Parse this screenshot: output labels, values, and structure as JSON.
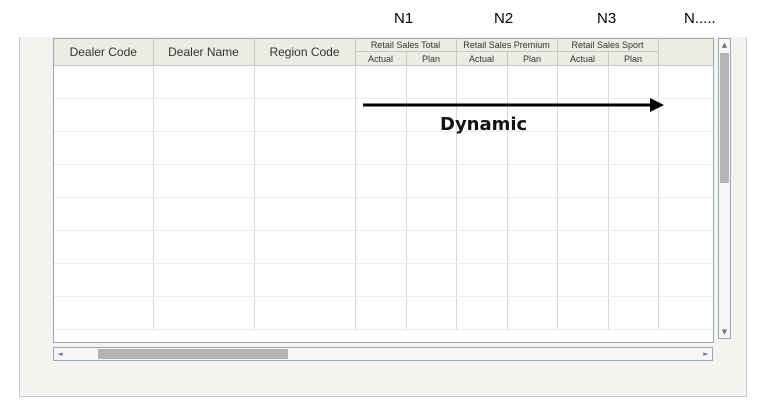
{
  "column_markers": [
    "N1",
    "N2",
    "N3",
    "N....."
  ],
  "grid": {
    "fixed_columns": [
      "Dealer Code",
      "Dealer Name",
      "Region Code"
    ],
    "groups": [
      {
        "label": "Retail Sales Total",
        "sub": [
          "Actual",
          "Plan"
        ]
      },
      {
        "label": "Retail Sales Premium",
        "sub": [
          "Actual",
          "Plan"
        ]
      },
      {
        "label": "Retail Sales Sport",
        "sub": [
          "Actual",
          "Plan"
        ]
      }
    ],
    "empty_row_count": 8
  },
  "scrollbars": {
    "up_arrow": "▲",
    "down_arrow": "▼",
    "left_arrow": "◄",
    "right_arrow": "►"
  },
  "annotation": {
    "label": "Dynamic",
    "arrow_icon": "right-arrow-icon"
  },
  "colors": {
    "header_bg": "#ecece4",
    "border": "#9aa9b8",
    "scroll_thumb": "#b4b4b4",
    "panel_bg": "#f3f3ef"
  }
}
